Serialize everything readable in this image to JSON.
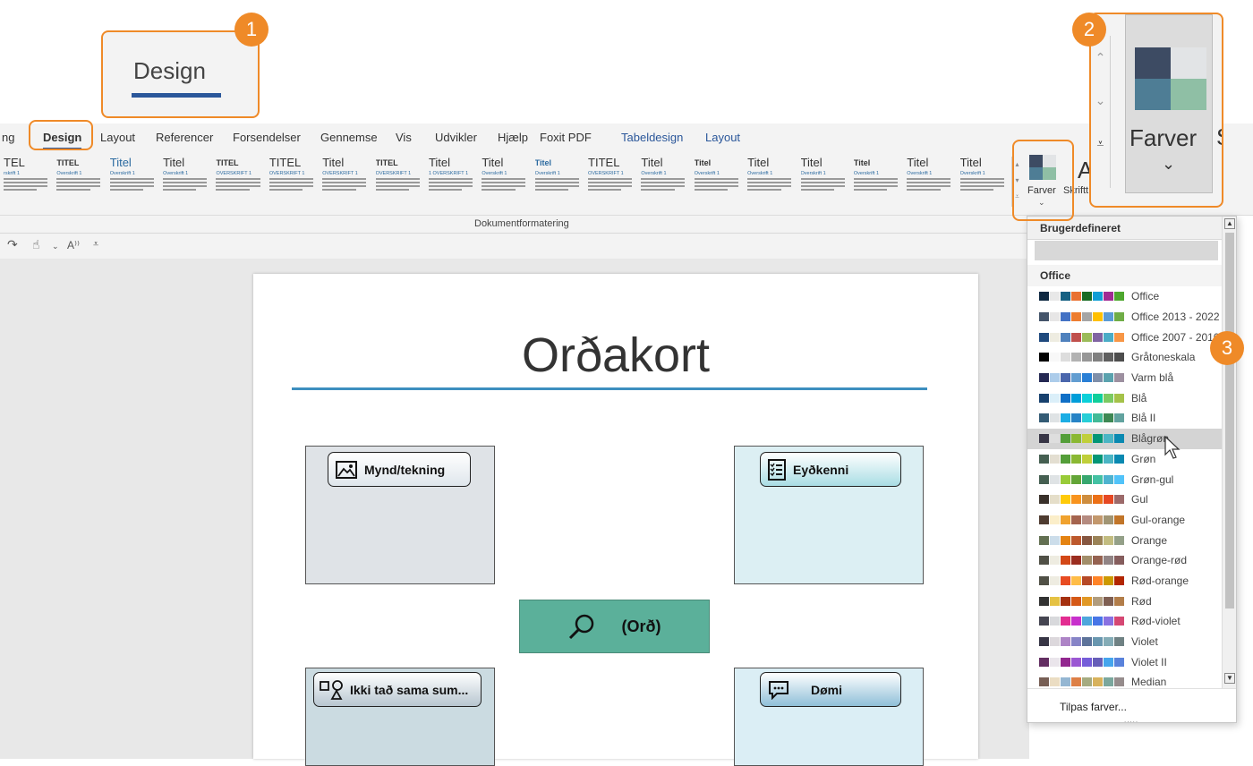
{
  "zoom_callout": {
    "design_label": "Design",
    "badge1": "1",
    "badge2": "2",
    "badge3": "3",
    "farver_big_label": "Farver",
    "sh_partial": "Sh"
  },
  "tabs": [
    "ng",
    "Design",
    "Layout",
    "Referencer",
    "Forsendelser",
    "Gennemse",
    "Vis",
    "Udvikler",
    "Hjælp",
    "Foxit PDF",
    "Tabeldesign",
    "Layout"
  ],
  "ribbon": {
    "group_label": "Dokumentformatering",
    "farver_label": "Farver",
    "skrifttyper_partial": "Skriftt",
    "skrift_letter": "A",
    "theme_titles": [
      "TEL",
      "TITEL",
      "Titel",
      "Titel",
      "TITEL",
      "TITEL",
      "Titel",
      "TITEL",
      "Titel",
      "Titel",
      "Titel",
      "TITEL",
      "Titel",
      "Titel",
      "Titel",
      "Titel",
      "Titel",
      "Titel",
      "Titel"
    ],
    "theme_headings": [
      "rskrift 1",
      "Overskrift 1",
      "Overskrift 1",
      "Overskrift 1",
      "OVERSKRIFT 1",
      "OVERSKRIFT 1",
      "OVERSKRIFT 1",
      "OVERSKRIFT 1",
      "1 OVERSKRIFT 1",
      "Overskrift 1",
      "Overskrift 1",
      "OVERSKRIFT 1",
      "Overskrift 1",
      "Overskrift 1",
      "Overskrift 1",
      "Overskrift 1",
      "Overskrift 1",
      "Overskrift 1",
      "Overskrift 1"
    ]
  },
  "qat": {
    "redo": "↷",
    "touch": "☝",
    "readaloud": "A⁾⁾",
    "more": "⩡"
  },
  "document": {
    "title": "Orðakort",
    "cards": {
      "top_left": "Mynd/tekning",
      "top_right": "Eyðkenni",
      "center": "(Orð)",
      "bottom_left": "Ikki tað sama sum...",
      "bottom_right": "Dømi"
    }
  },
  "colors_dropdown": {
    "section_custom": "Brugerdefineret",
    "section_office": "Office",
    "items": [
      {
        "label": "Office",
        "swatches": [
          "#0e2841",
          "#e8e8e8",
          "#156082",
          "#e97132",
          "#196b24",
          "#0f9ed5",
          "#a02b93",
          "#4ea72e"
        ]
      },
      {
        "label": "Office 2013 - 2022",
        "swatches": [
          "#44546a",
          "#e7e6e6",
          "#4472c4",
          "#ed7d31",
          "#a5a5a5",
          "#ffc000",
          "#5b9bd5",
          "#70ad47"
        ]
      },
      {
        "label": "Office 2007 - 2010",
        "swatches": [
          "#1f497d",
          "#eeece1",
          "#4f81bd",
          "#c0504d",
          "#9bbb59",
          "#8064a2",
          "#4bacc6",
          "#f79646"
        ]
      },
      {
        "label": "Gråtoneskala",
        "swatches": [
          "#000000",
          "#f8f8f8",
          "#dddddd",
          "#b2b2b2",
          "#969696",
          "#808080",
          "#5f5f5f",
          "#4d4d4d"
        ]
      },
      {
        "label": "Varm blå",
        "swatches": [
          "#242852",
          "#acccea",
          "#4a66ac",
          "#629dd1",
          "#297fd5",
          "#7f8fa9",
          "#5aa2ae",
          "#9d90a0"
        ]
      },
      {
        "label": "Blå",
        "swatches": [
          "#17406d",
          "#dbeff9",
          "#0f6fc6",
          "#009dd9",
          "#0bd0d9",
          "#10cf9b",
          "#7cca62",
          "#a5c249"
        ]
      },
      {
        "label": "Blå II",
        "swatches": [
          "#335b74",
          "#dfe3e5",
          "#1cade4",
          "#2683c6",
          "#27ced7",
          "#42ba97",
          "#3e8853",
          "#62a39f"
        ]
      },
      {
        "label": "Blågrøn",
        "swatches": [
          "#373545",
          "#dedede",
          "#549e39",
          "#8ab833",
          "#c0cf3a",
          "#029676",
          "#4ab5c4",
          "#0989b1"
        ]
      },
      {
        "label": "Grøn",
        "swatches": [
          "#455f51",
          "#e3ded1",
          "#549e39",
          "#8ab833",
          "#c0cf3a",
          "#029676",
          "#4ab5c4",
          "#0989b1"
        ]
      },
      {
        "label": "Grøn-gul",
        "swatches": [
          "#455f51",
          "#dfe3e5",
          "#99cb38",
          "#63a537",
          "#37a76f",
          "#44c1a3",
          "#4eb3cf",
          "#51c3f9"
        ]
      },
      {
        "label": "Gul",
        "swatches": [
          "#39302a",
          "#e5dec9",
          "#ffca08",
          "#f8931d",
          "#ce8d3e",
          "#ec7016",
          "#e64823",
          "#9c6a6a"
        ]
      },
      {
        "label": "Gul-orange",
        "swatches": [
          "#4e3b30",
          "#fbeec9",
          "#f0a22e",
          "#a5644e",
          "#b58b80",
          "#c3986d",
          "#a19574",
          "#c17529"
        ]
      },
      {
        "label": "Orange",
        "swatches": [
          "#637052",
          "#ccddea",
          "#e48312",
          "#bd582c",
          "#865640",
          "#9b8357",
          "#c2bc80",
          "#94a088"
        ]
      },
      {
        "label": "Orange-rød",
        "swatches": [
          "#505046",
          "#eeece1",
          "#d34817",
          "#9b2d1f",
          "#a28e6a",
          "#956251",
          "#918485",
          "#855d5d"
        ]
      },
      {
        "label": "Rød-orange",
        "swatches": [
          "#505046",
          "#eeece1",
          "#e84c22",
          "#ffbd47",
          "#b64926",
          "#ff8427",
          "#cc9900",
          "#b22600"
        ]
      },
      {
        "label": "Rød",
        "swatches": [
          "#323232",
          "#e5c243",
          "#a5300f",
          "#d55816",
          "#e19825",
          "#b19c7d",
          "#7f5f52",
          "#b27d49"
        ]
      },
      {
        "label": "Rød-violet",
        "swatches": [
          "#454551",
          "#d8d9dc",
          "#e32d91",
          "#c830cc",
          "#4ea6dc",
          "#4775e7",
          "#8971e1",
          "#d54773"
        ]
      },
      {
        "label": "Violet",
        "swatches": [
          "#373545",
          "#dcd8dc",
          "#ad84c6",
          "#8784c7",
          "#5d739a",
          "#6997af",
          "#84acb6",
          "#6f8183"
        ]
      },
      {
        "label": "Violet II",
        "swatches": [
          "#632e62",
          "#eae5eb",
          "#92278f",
          "#9b57d3",
          "#755dd9",
          "#665eb8",
          "#45a5ed",
          "#5982db"
        ]
      },
      {
        "label": "Median",
        "swatches": [
          "#775f55",
          "#ebddc3",
          "#94b6d2",
          "#dd8047",
          "#a5ab81",
          "#d8b25c",
          "#7ba79d",
          "#968c8c"
        ]
      }
    ],
    "hovered_index": 7,
    "footer": "Tilpas farver...",
    "grip": "....."
  }
}
